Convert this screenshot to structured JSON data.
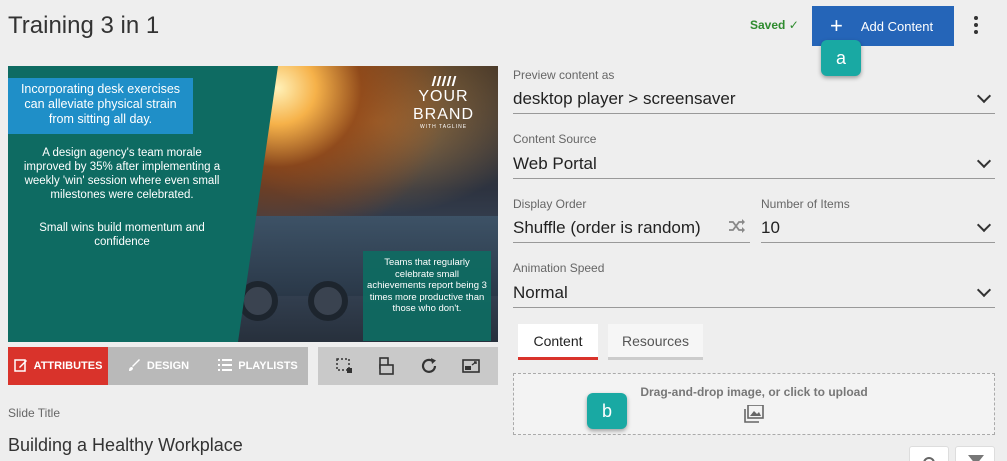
{
  "header": {
    "title": "Training 3 in 1",
    "saved_label": "Saved ✓",
    "add_content_label": "Add Content"
  },
  "callouts": {
    "a": "a",
    "b": "b"
  },
  "slide": {
    "blue_box_text": "Incorporating desk exercises can alleviate physical strain from sitting all day.",
    "paragraph1": "A design agency's team morale improved by 35% after implementing a weekly 'win' session where even small milestones were celebrated.",
    "paragraph2": "Small wins build momentum and confidence",
    "brand_name": "YOUR BRAND",
    "brand_tagline": "WITH TAGLINE",
    "teal_box_text": "Teams that regularly celebrate small achievements report being 3 times more productive than those who don't."
  },
  "slide_tabs": {
    "attributes": "ATTRIBUTES",
    "design": "DESIGN",
    "playlists": "PLAYLISTS"
  },
  "slide_title": {
    "label": "Slide Title",
    "value": "Building a Healthy Workplace"
  },
  "form": {
    "preview_label": "Preview content as",
    "preview_value": "desktop player > screensaver",
    "source_label": "Content Source",
    "source_value": "Web Portal",
    "order_label": "Display Order",
    "order_value": "Shuffle (order is random)",
    "items_label": "Number of Items",
    "items_value": "10",
    "speed_label": "Animation Speed",
    "speed_value": "Normal"
  },
  "content_tabs": {
    "content": "Content",
    "resources": "Resources"
  },
  "dropzone_text": "Drag-and-drop image, or click to upload",
  "colors": {
    "accent_blue": "#2565b8",
    "accent_red": "#d9332b",
    "callout_teal": "#19a9a3",
    "saved_green": "#2e8b2e"
  }
}
